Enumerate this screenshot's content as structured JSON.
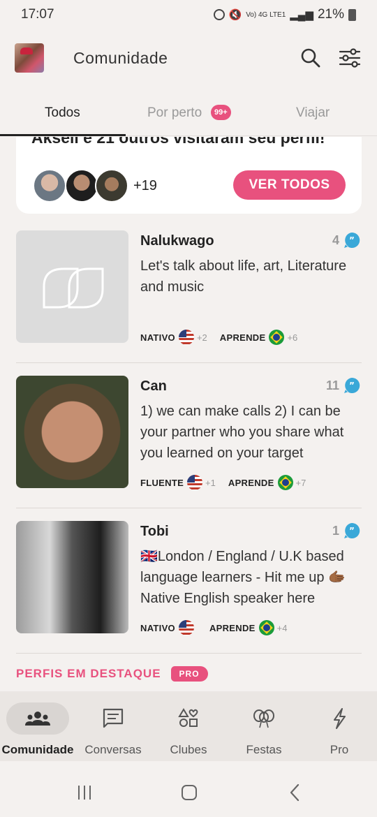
{
  "status_bar": {
    "time": "17:07",
    "network": "Vo) 4G LTE1",
    "battery": "21%"
  },
  "header": {
    "title": "Comunidade"
  },
  "tabs": [
    {
      "label": "Todos",
      "active": true
    },
    {
      "label": "Por perto",
      "badge": "99+"
    },
    {
      "label": "Viajar"
    }
  ],
  "visitors": {
    "title": "Aksell e 21 outros visitaram seu perfil!",
    "extra_count": "+19",
    "button": "VER TODOS"
  },
  "profiles": [
    {
      "name": "Nalukwago",
      "count": "4",
      "bio": "Let's talk about life, art, Literature and music",
      "native_label": "NATIVO",
      "native_extra": "+2",
      "learn_label": "APRENDE",
      "learn_extra": "+6"
    },
    {
      "name": "Can",
      "count": "11",
      "bio": "1) we can make calls 2) I can be your partner who you share what you learned on your target",
      "native_label": "FLUENTE",
      "native_extra": "+1",
      "learn_label": "APRENDE",
      "learn_extra": "+7"
    },
    {
      "name": "Tobi",
      "count": "1",
      "bio": "🇬🇧London / England / U.K based language learners - Hit me up 🫱🏾 Native English speaker here",
      "native_label": "NATIVO",
      "native_extra": "",
      "learn_label": "APRENDE",
      "learn_extra": "+4"
    }
  ],
  "featured": {
    "title": "PERFIS EM DESTAQUE",
    "badge": "PRO"
  },
  "bottom_nav": [
    {
      "label": "Comunidade",
      "icon": "community-icon",
      "active": true
    },
    {
      "label": "Conversas",
      "icon": "chat-icon"
    },
    {
      "label": "Clubes",
      "icon": "clubs-icon"
    },
    {
      "label": "Festas",
      "icon": "balloons-icon"
    },
    {
      "label": "Pro",
      "icon": "lightning-icon"
    }
  ],
  "colors": {
    "accent": "#e8517e",
    "background": "#f4f1ef",
    "quote": "#3aa8d8"
  }
}
